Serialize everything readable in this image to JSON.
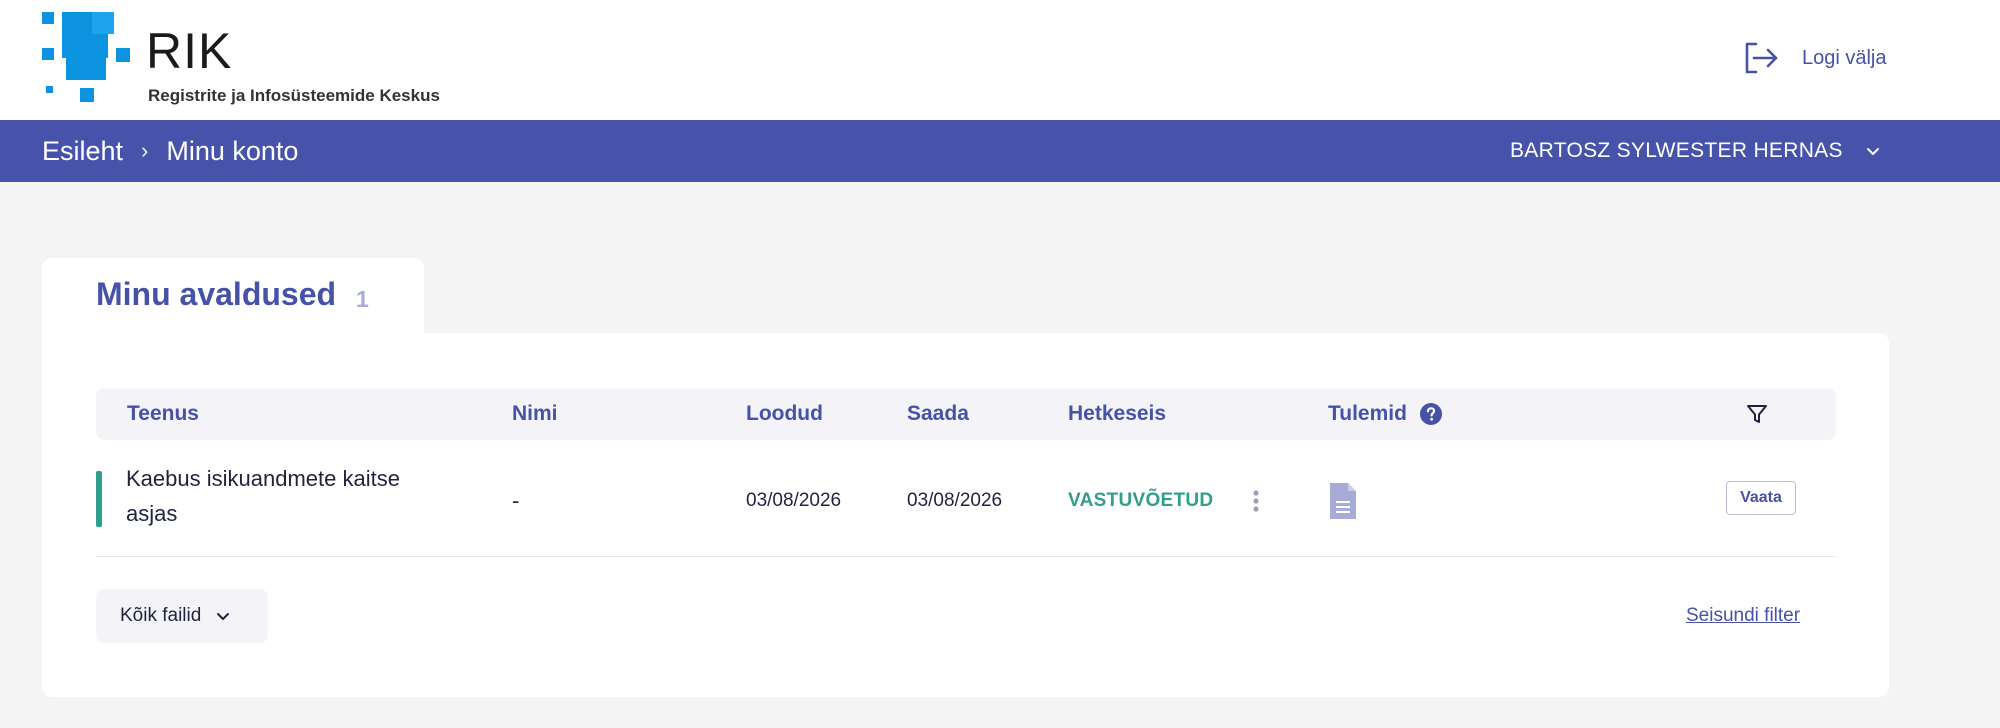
{
  "brand": {
    "name": "RIK",
    "subtitle": "Registrite ja Infosüsteemide Keskus",
    "colors": {
      "primary": "#4753aa",
      "accent": "#2f9e8c",
      "logo_blue": "#0b93e0"
    }
  },
  "header": {
    "logout_label": "Logi välja",
    "logout_icon": "logout-icon"
  },
  "navbar": {
    "breadcrumb": [
      "Esileht",
      "Minu konto"
    ],
    "user_name": "BARTOSZ SYLWESTER HERNAS"
  },
  "tab": {
    "title": "Minu avaldused",
    "count": "1"
  },
  "table": {
    "columns": [
      "Teenus",
      "Nimi",
      "Loodud",
      "Saada",
      "Hetkeseis",
      "Tulemid"
    ],
    "rows": [
      {
        "service": "Kaebus isikuandmete kaitse asjas",
        "name": "-",
        "created": "03/08/2026",
        "sent": "03/08/2026",
        "status": "VASTUVÕETUD",
        "view_label": "Vaata"
      }
    ]
  },
  "footer": {
    "all_files_label": "Kõik failid",
    "state_filter_label": "Seisundi filter"
  }
}
